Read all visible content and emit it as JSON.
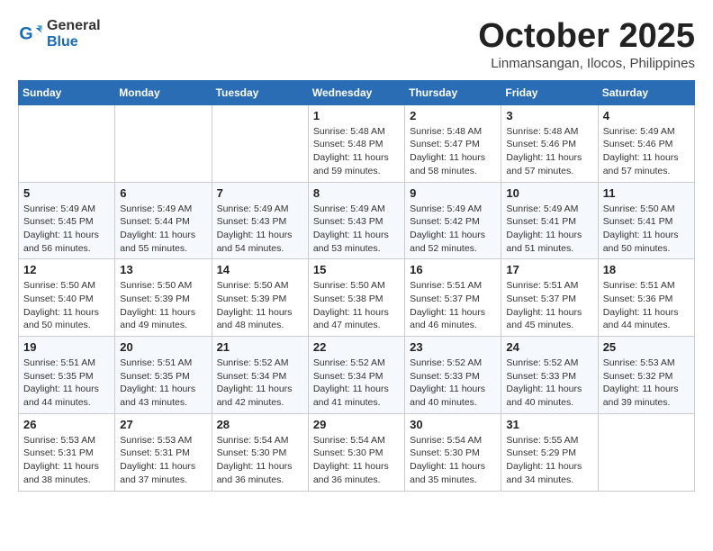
{
  "header": {
    "logo_general": "General",
    "logo_blue": "Blue",
    "month_title": "October 2025",
    "location": "Linmansangan, Ilocos, Philippines"
  },
  "weekdays": [
    "Sunday",
    "Monday",
    "Tuesday",
    "Wednesday",
    "Thursday",
    "Friday",
    "Saturday"
  ],
  "weeks": [
    [
      {
        "day": "",
        "info": ""
      },
      {
        "day": "",
        "info": ""
      },
      {
        "day": "",
        "info": ""
      },
      {
        "day": "1",
        "info": "Sunrise: 5:48 AM\nSunset: 5:48 PM\nDaylight: 11 hours\nand 59 minutes."
      },
      {
        "day": "2",
        "info": "Sunrise: 5:48 AM\nSunset: 5:47 PM\nDaylight: 11 hours\nand 58 minutes."
      },
      {
        "day": "3",
        "info": "Sunrise: 5:48 AM\nSunset: 5:46 PM\nDaylight: 11 hours\nand 57 minutes."
      },
      {
        "day": "4",
        "info": "Sunrise: 5:49 AM\nSunset: 5:46 PM\nDaylight: 11 hours\nand 57 minutes."
      }
    ],
    [
      {
        "day": "5",
        "info": "Sunrise: 5:49 AM\nSunset: 5:45 PM\nDaylight: 11 hours\nand 56 minutes."
      },
      {
        "day": "6",
        "info": "Sunrise: 5:49 AM\nSunset: 5:44 PM\nDaylight: 11 hours\nand 55 minutes."
      },
      {
        "day": "7",
        "info": "Sunrise: 5:49 AM\nSunset: 5:43 PM\nDaylight: 11 hours\nand 54 minutes."
      },
      {
        "day": "8",
        "info": "Sunrise: 5:49 AM\nSunset: 5:43 PM\nDaylight: 11 hours\nand 53 minutes."
      },
      {
        "day": "9",
        "info": "Sunrise: 5:49 AM\nSunset: 5:42 PM\nDaylight: 11 hours\nand 52 minutes."
      },
      {
        "day": "10",
        "info": "Sunrise: 5:49 AM\nSunset: 5:41 PM\nDaylight: 11 hours\nand 51 minutes."
      },
      {
        "day": "11",
        "info": "Sunrise: 5:50 AM\nSunset: 5:41 PM\nDaylight: 11 hours\nand 50 minutes."
      }
    ],
    [
      {
        "day": "12",
        "info": "Sunrise: 5:50 AM\nSunset: 5:40 PM\nDaylight: 11 hours\nand 50 minutes."
      },
      {
        "day": "13",
        "info": "Sunrise: 5:50 AM\nSunset: 5:39 PM\nDaylight: 11 hours\nand 49 minutes."
      },
      {
        "day": "14",
        "info": "Sunrise: 5:50 AM\nSunset: 5:39 PM\nDaylight: 11 hours\nand 48 minutes."
      },
      {
        "day": "15",
        "info": "Sunrise: 5:50 AM\nSunset: 5:38 PM\nDaylight: 11 hours\nand 47 minutes."
      },
      {
        "day": "16",
        "info": "Sunrise: 5:51 AM\nSunset: 5:37 PM\nDaylight: 11 hours\nand 46 minutes."
      },
      {
        "day": "17",
        "info": "Sunrise: 5:51 AM\nSunset: 5:37 PM\nDaylight: 11 hours\nand 45 minutes."
      },
      {
        "day": "18",
        "info": "Sunrise: 5:51 AM\nSunset: 5:36 PM\nDaylight: 11 hours\nand 44 minutes."
      }
    ],
    [
      {
        "day": "19",
        "info": "Sunrise: 5:51 AM\nSunset: 5:35 PM\nDaylight: 11 hours\nand 44 minutes."
      },
      {
        "day": "20",
        "info": "Sunrise: 5:51 AM\nSunset: 5:35 PM\nDaylight: 11 hours\nand 43 minutes."
      },
      {
        "day": "21",
        "info": "Sunrise: 5:52 AM\nSunset: 5:34 PM\nDaylight: 11 hours\nand 42 minutes."
      },
      {
        "day": "22",
        "info": "Sunrise: 5:52 AM\nSunset: 5:34 PM\nDaylight: 11 hours\nand 41 minutes."
      },
      {
        "day": "23",
        "info": "Sunrise: 5:52 AM\nSunset: 5:33 PM\nDaylight: 11 hours\nand 40 minutes."
      },
      {
        "day": "24",
        "info": "Sunrise: 5:52 AM\nSunset: 5:33 PM\nDaylight: 11 hours\nand 40 minutes."
      },
      {
        "day": "25",
        "info": "Sunrise: 5:53 AM\nSunset: 5:32 PM\nDaylight: 11 hours\nand 39 minutes."
      }
    ],
    [
      {
        "day": "26",
        "info": "Sunrise: 5:53 AM\nSunset: 5:31 PM\nDaylight: 11 hours\nand 38 minutes."
      },
      {
        "day": "27",
        "info": "Sunrise: 5:53 AM\nSunset: 5:31 PM\nDaylight: 11 hours\nand 37 minutes."
      },
      {
        "day": "28",
        "info": "Sunrise: 5:54 AM\nSunset: 5:30 PM\nDaylight: 11 hours\nand 36 minutes."
      },
      {
        "day": "29",
        "info": "Sunrise: 5:54 AM\nSunset: 5:30 PM\nDaylight: 11 hours\nand 36 minutes."
      },
      {
        "day": "30",
        "info": "Sunrise: 5:54 AM\nSunset: 5:30 PM\nDaylight: 11 hours\nand 35 minutes."
      },
      {
        "day": "31",
        "info": "Sunrise: 5:55 AM\nSunset: 5:29 PM\nDaylight: 11 hours\nand 34 minutes."
      },
      {
        "day": "",
        "info": ""
      }
    ]
  ]
}
